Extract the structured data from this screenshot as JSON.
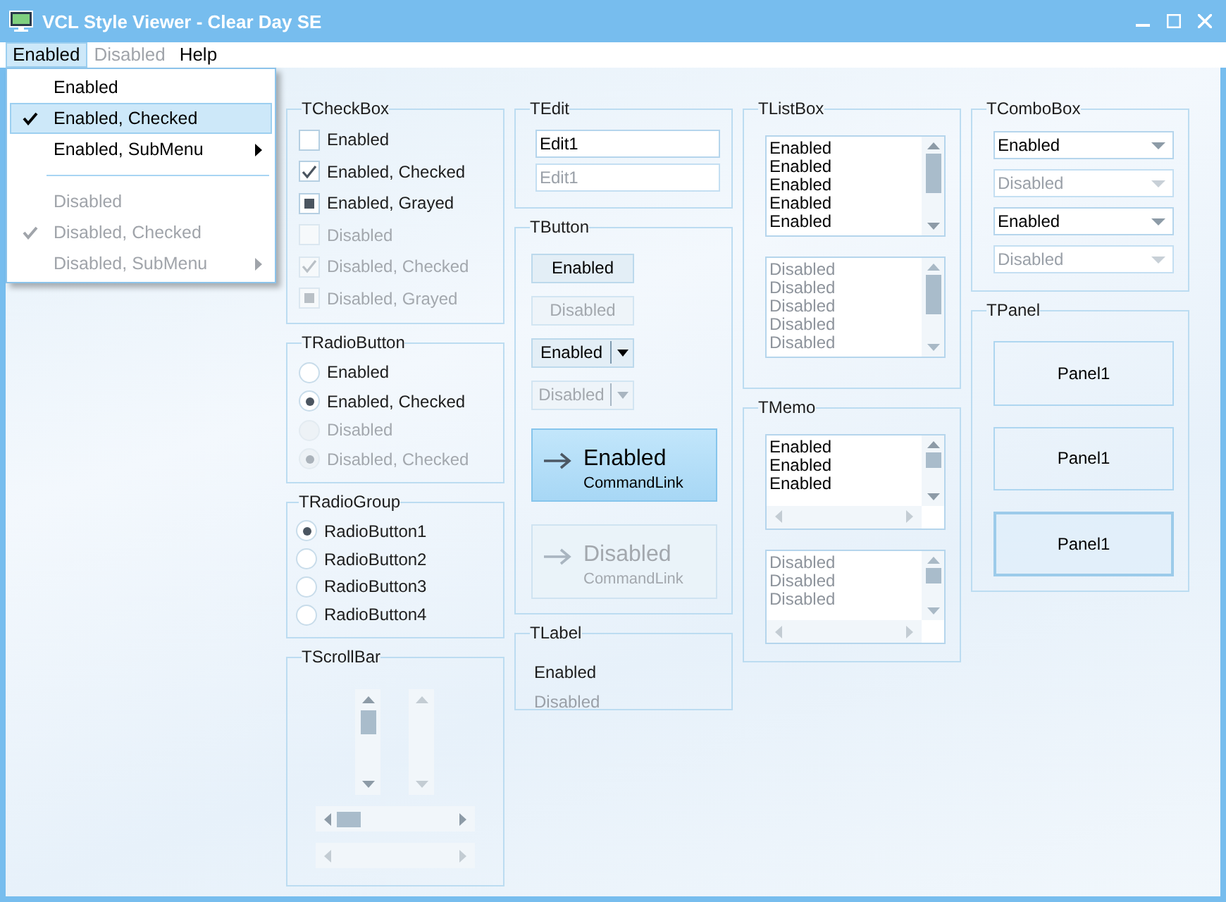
{
  "window": {
    "title": "VCL Style Viewer - Clear Day SE"
  },
  "menu_bar": [
    {
      "label": "Enabled",
      "selected": true,
      "disabled": false
    },
    {
      "label": "Disabled",
      "selected": false,
      "disabled": true
    },
    {
      "label": "Help",
      "selected": false,
      "disabled": false
    }
  ],
  "dropdown_menu": [
    {
      "kind": "item",
      "label": "Enabled",
      "checked": false,
      "disabled": false,
      "submenu": false,
      "selected": false
    },
    {
      "kind": "item",
      "label": "Enabled, Checked",
      "checked": true,
      "disabled": false,
      "submenu": false,
      "selected": true
    },
    {
      "kind": "item",
      "label": "Enabled, SubMenu",
      "checked": false,
      "disabled": false,
      "submenu": true,
      "selected": false
    },
    {
      "kind": "separator"
    },
    {
      "kind": "item",
      "label": "Disabled",
      "checked": false,
      "disabled": true,
      "submenu": false,
      "selected": false
    },
    {
      "kind": "item",
      "label": "Disabled, Checked",
      "checked": true,
      "disabled": true,
      "submenu": false,
      "selected": false
    },
    {
      "kind": "item",
      "label": "Disabled, SubMenu",
      "checked": false,
      "disabled": true,
      "submenu": true,
      "selected": false
    }
  ],
  "columns": [
    [
      {
        "kind": "checkbox",
        "title": "TCheckBox",
        "items": [
          {
            "label": "Enabled",
            "checked": false,
            "grayed": false,
            "disabled": false
          },
          {
            "label": "Enabled, Checked",
            "checked": true,
            "grayed": false,
            "disabled": false
          },
          {
            "label": "Enabled, Grayed",
            "checked": false,
            "grayed": true,
            "disabled": false
          },
          {
            "label": "Disabled",
            "checked": false,
            "grayed": false,
            "disabled": true
          },
          {
            "label": "Disabled, Checked",
            "checked": true,
            "grayed": false,
            "disabled": true
          },
          {
            "label": "Disabled, Grayed",
            "checked": false,
            "grayed": true,
            "disabled": true
          }
        ]
      },
      {
        "kind": "radio",
        "title": "TRadioButton",
        "items": [
          {
            "label": "Enabled",
            "checked": false,
            "disabled": false
          },
          {
            "label": "Enabled, Checked",
            "checked": true,
            "disabled": false
          },
          {
            "label": "Disabled",
            "checked": false,
            "disabled": true
          },
          {
            "label": "Disabled, Checked",
            "checked": true,
            "disabled": true
          }
        ]
      },
      {
        "kind": "radiogroup",
        "title": "TRadioGroup",
        "items": [
          {
            "label": "RadioButton1",
            "selected": true
          },
          {
            "label": "RadioButton2",
            "selected": false
          },
          {
            "label": "RadioButton3",
            "selected": false
          },
          {
            "label": "RadioButton4",
            "selected": false
          }
        ]
      },
      {
        "kind": "scrollbar",
        "title": "TScrollBar",
        "items": [
          {
            "kind": "vertical",
            "disabled": false
          },
          {
            "kind": "vertical",
            "disabled": true
          },
          {
            "kind": "horizontal",
            "disabled": false
          },
          {
            "kind": "horizontal",
            "disabled": true
          }
        ]
      }
    ],
    [
      {
        "kind": "edit",
        "title": "TEdit",
        "items": [
          {
            "value": "Edit1",
            "disabled": false
          },
          {
            "value": "Edit1",
            "disabled": true
          }
        ]
      },
      {
        "kind": "button",
        "title": "TButton",
        "items": [
          {
            "kind": "push",
            "label": "Enabled",
            "disabled": false
          },
          {
            "kind": "push",
            "label": "Disabled",
            "disabled": true
          },
          {
            "kind": "split",
            "label": "Enabled",
            "disabled": false
          },
          {
            "kind": "split",
            "label": "Disabled",
            "disabled": true
          },
          {
            "kind": "commandlink",
            "label": "Enabled",
            "note": "CommandLink",
            "disabled": false,
            "hot": true
          },
          {
            "kind": "commandlink",
            "label": "Disabled",
            "note": "CommandLink",
            "disabled": true,
            "hot": false
          }
        ]
      },
      {
        "kind": "label",
        "title": "TLabel",
        "items": [
          {
            "text": "Enabled",
            "disabled": false
          },
          {
            "text": "Disabled",
            "disabled": true
          }
        ]
      }
    ],
    [
      {
        "kind": "listbox",
        "title": "TListBox",
        "items": [
          {
            "lines": [
              "Enabled",
              "Enabled",
              "Enabled",
              "Enabled",
              "Enabled"
            ],
            "disabled": false
          },
          {
            "lines": [
              "Disabled",
              "Disabled",
              "Disabled",
              "Disabled",
              "Disabled"
            ],
            "disabled": true
          }
        ]
      },
      {
        "kind": "memo",
        "title": "TMemo",
        "items": [
          {
            "lines": [
              "Enabled",
              "Enabled",
              "Enabled"
            ],
            "disabled": false
          },
          {
            "lines": [
              "Disabled",
              "Disabled",
              "Disabled"
            ],
            "disabled": true
          }
        ]
      }
    ],
    [
      {
        "kind": "combobox",
        "title": "TComboBox",
        "items": [
          {
            "value": "Enabled",
            "disabled": false
          },
          {
            "value": "Disabled",
            "disabled": true
          },
          {
            "value": "Enabled",
            "disabled": false
          },
          {
            "value": "Disabled",
            "disabled": true
          }
        ]
      },
      {
        "kind": "panel",
        "title": "TPanel",
        "items": [
          {
            "caption": "Panel1",
            "focused": false
          },
          {
            "caption": "Panel1",
            "focused": false
          },
          {
            "caption": "Panel1",
            "focused": true
          }
        ]
      }
    ]
  ]
}
